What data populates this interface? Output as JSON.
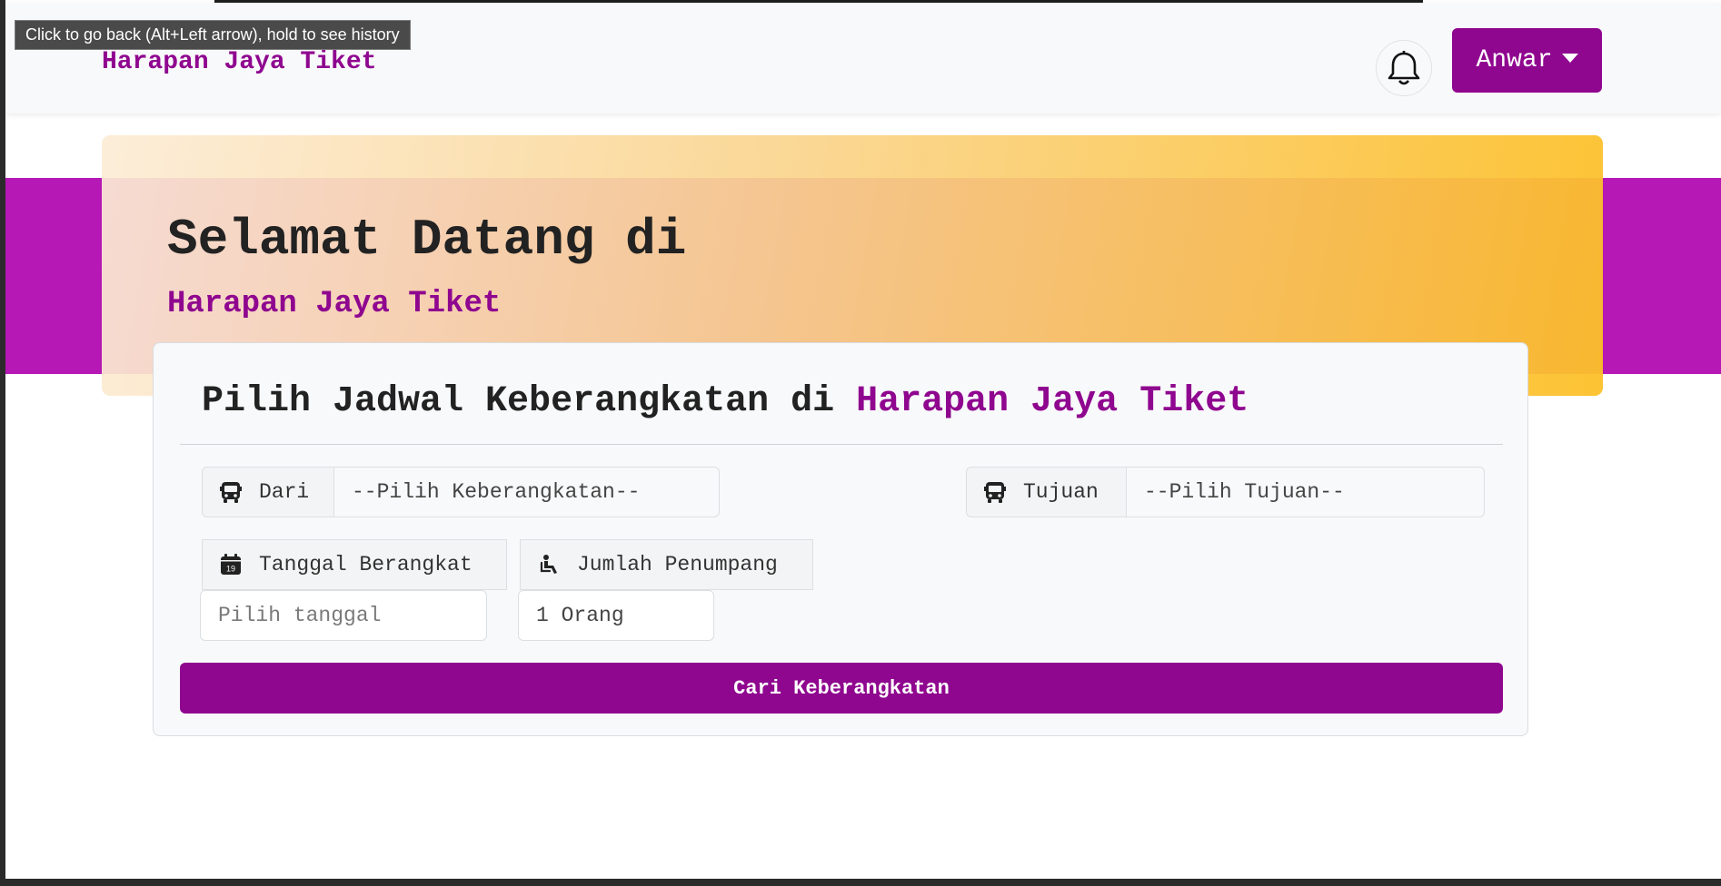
{
  "tooltip": "Click to go back (Alt+Left arrow), hold to see history",
  "navbar": {
    "brand": "Harapan Jaya Tiket",
    "notification_icon": "bell-icon",
    "user_name": "Anwar"
  },
  "hero": {
    "title": "Selamat Datang di",
    "subtitle": "Harapan Jaya Tiket"
  },
  "form": {
    "heading_prefix": "Pilih Jadwal Keberangkatan di",
    "heading_accent": "Harapan Jaya Tiket",
    "dari_label": "Dari",
    "dari_value": "--Pilih Keberangkatan--",
    "tujuan_label": "Tujuan",
    "tujuan_value": "--Pilih Tujuan--",
    "tanggal_label": "Tanggal Berangkat",
    "tanggal_placeholder": "Pilih tanggal",
    "penumpang_label": "Jumlah Penumpang",
    "penumpang_value": "1 Orang",
    "calendar_day": "19",
    "submit_label": "Cari Keberangkatan"
  },
  "colors": {
    "brand": "#8f068f",
    "band": "#b518b5",
    "hero_gradient_end": "#fbbf24"
  }
}
